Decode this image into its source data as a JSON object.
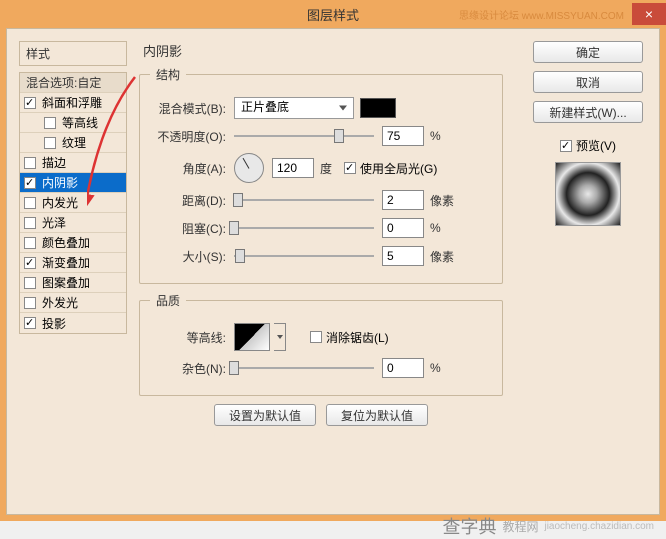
{
  "window": {
    "title": "图层样式",
    "watermark_top": "思缘设计论坛  www.MISSYUAN.COM",
    "close": "×"
  },
  "left": {
    "styles_label": "样式",
    "blend_header": "混合选项:自定",
    "items": [
      {
        "label": "斜面和浮雕",
        "checked": true,
        "indent": false
      },
      {
        "label": "等高线",
        "checked": false,
        "indent": true
      },
      {
        "label": "纹理",
        "checked": false,
        "indent": true
      },
      {
        "label": "描边",
        "checked": false,
        "indent": false
      },
      {
        "label": "内阴影",
        "checked": true,
        "indent": false,
        "selected": true
      },
      {
        "label": "内发光",
        "checked": false,
        "indent": false
      },
      {
        "label": "光泽",
        "checked": false,
        "indent": false
      },
      {
        "label": "颜色叠加",
        "checked": false,
        "indent": false
      },
      {
        "label": "渐变叠加",
        "checked": true,
        "indent": false
      },
      {
        "label": "图案叠加",
        "checked": false,
        "indent": false
      },
      {
        "label": "外发光",
        "checked": false,
        "indent": false
      },
      {
        "label": "投影",
        "checked": true,
        "indent": false
      }
    ]
  },
  "center": {
    "title": "内阴影",
    "struct_legend": "结构",
    "blend_mode_label": "混合模式(B):",
    "blend_mode_value": "正片叠底",
    "opacity_label": "不透明度(O):",
    "opacity_val": "75",
    "opacity_unit": "%",
    "angle_label": "角度(A):",
    "angle_val": "120",
    "angle_unit": "度",
    "global_light": "使用全局光(G)",
    "distance_label": "距离(D):",
    "distance_val": "2",
    "distance_unit": "像素",
    "choke_label": "阻塞(C):",
    "choke_val": "0",
    "choke_unit": "%",
    "size_label": "大小(S):",
    "size_val": "5",
    "size_unit": "像素",
    "quality_legend": "品质",
    "contour_label": "等高线:",
    "antialias": "消除锯齿(L)",
    "noise_label": "杂色(N):",
    "noise_val": "0",
    "noise_unit": "%",
    "btn_default": "设置为默认值",
    "btn_reset": "复位为默认值"
  },
  "right": {
    "ok": "确定",
    "cancel": "取消",
    "new_style": "新建样式(W)...",
    "preview_label": "预览(V)"
  },
  "bottom_watermark": {
    "big": "查字典",
    "tag": "教程网",
    "sub": "jiaocheng.chazidian.com"
  }
}
